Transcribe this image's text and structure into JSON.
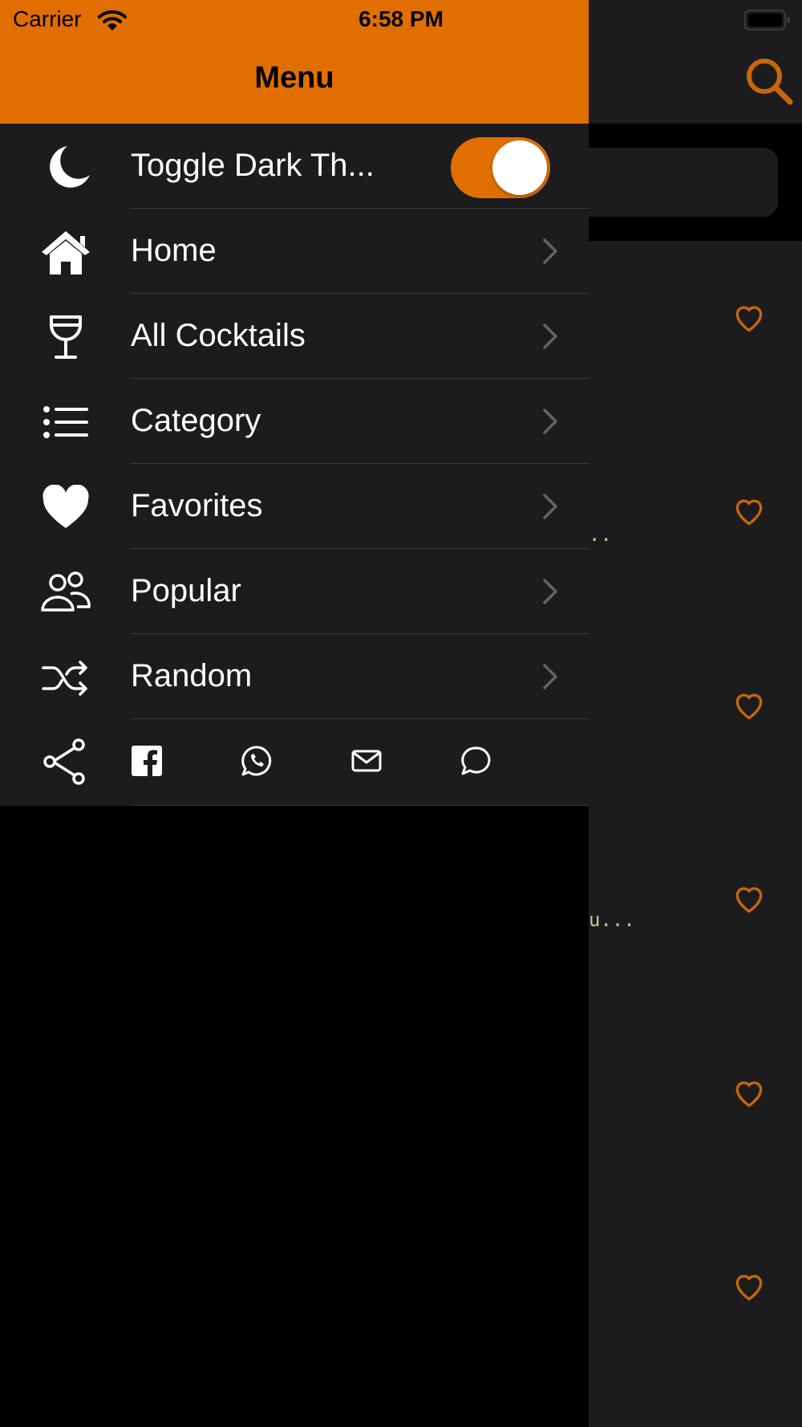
{
  "status_bar": {
    "carrier": "Carrier",
    "time": "6:58 PM"
  },
  "drawer": {
    "title": "Menu",
    "dark_toggle": {
      "label": "Toggle Dark Th...",
      "icon": "moon-icon",
      "on": true
    },
    "items": [
      {
        "label": "Home",
        "icon": "home-icon"
      },
      {
        "label": "All Cocktails",
        "icon": "wine-glass-icon"
      },
      {
        "label": "Category",
        "icon": "list-icon"
      },
      {
        "label": "Favorites",
        "icon": "heart-icon"
      },
      {
        "label": "Popular",
        "icon": "users-icon"
      },
      {
        "label": "Random",
        "icon": "shuffle-icon"
      }
    ],
    "share": {
      "icon": "share-icon",
      "buttons": [
        "facebook-icon",
        "whatsapp-icon",
        "mail-icon",
        "message-icon"
      ]
    }
  },
  "background": {
    "snippets": [
      "..",
      "u..."
    ],
    "favorite_icons": 6
  },
  "colors": {
    "accent": "#e06e00",
    "panel": "#1c1c1e",
    "divider": "#3a3a3c",
    "heart": "#c8660a"
  }
}
